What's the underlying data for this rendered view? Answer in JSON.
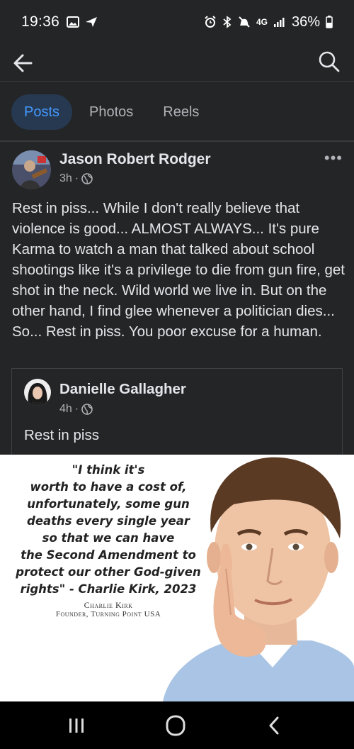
{
  "status": {
    "time": "19:36",
    "network": "4G",
    "battery": "36%"
  },
  "tabs": [
    {
      "label": "Posts"
    },
    {
      "label": "Photos"
    },
    {
      "label": "Reels"
    }
  ],
  "post": {
    "author": "Jason Robert Rodger",
    "time": "3h",
    "text": "Rest in piss... While I don't really believe that violence is good... ALMOST ALWAYS... It's pure Karma to watch a man that talked about school shootings like it's a privilege to die from gun fire, get shot in the neck. Wild world we live in. But on the other hand, I find glee whenever a politician dies... So... Rest in piss. You poor excuse for a human."
  },
  "shared": {
    "author": "Danielle Gallagher",
    "time": "4h",
    "text": "Rest in piss"
  },
  "meme": {
    "quote_lines": [
      "\"I think it's",
      "worth to have a cost of,",
      "unfortunately, some gun",
      "deaths every single year",
      "so that we can have",
      "the Second Amendment to",
      "protect our other God-given",
      "rights\" - Charlie Kirk, 2023"
    ],
    "caption_name": "Charlie Kirk",
    "caption_title": "Founder, Turning Point USA"
  },
  "colors": {
    "background": "#242526",
    "active_tab_bg": "#263951",
    "active_tab_text": "#4599ff",
    "text": "#e4e6eb",
    "muted": "#b0b3b8"
  }
}
